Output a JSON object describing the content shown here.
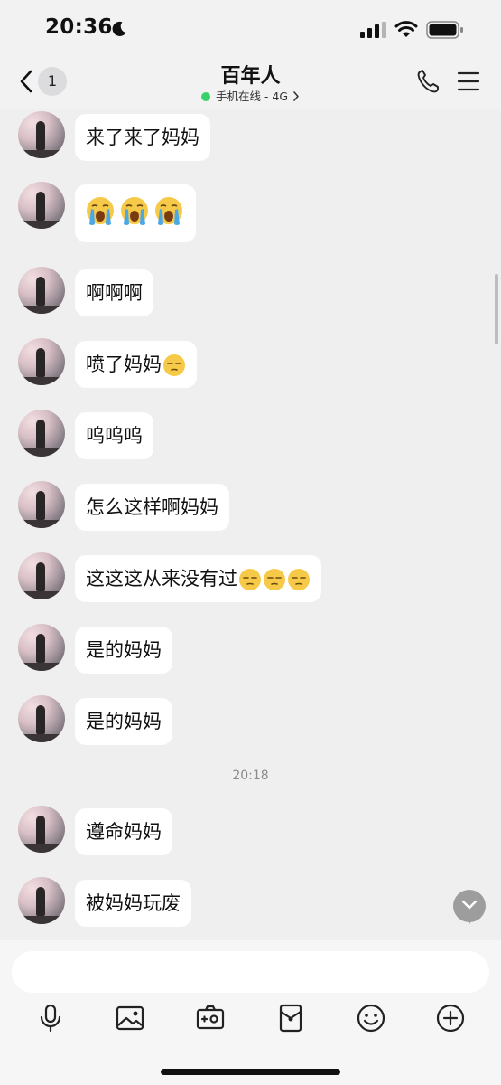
{
  "status_bar": {
    "time": "20:36",
    "icons": [
      "moon-icon",
      "signal-icon",
      "wifi-icon",
      "battery-icon"
    ]
  },
  "nav": {
    "unread_count": "1",
    "title": "百年人",
    "status": "手机在线 - 4G",
    "icons": [
      "back-chevron-icon",
      "phone-icon",
      "menu-icon"
    ]
  },
  "messages": [
    {
      "text": "来了来了妈妈"
    },
    {
      "emoji": [
        "loudly-crying-emoji",
        "loudly-crying-emoji",
        "loudly-crying-emoji"
      ]
    },
    {
      "text": "啊啊啊"
    },
    {
      "text": "喷了妈妈",
      "emoji": [
        "unamused-emoji"
      ]
    },
    {
      "text": "呜呜呜"
    },
    {
      "text": "怎么这样啊妈妈"
    },
    {
      "text": "这这这从来没有过",
      "emoji": [
        "unamused-emoji",
        "unamused-emoji",
        "unamused-emoji"
      ]
    },
    {
      "text": "是的妈妈"
    },
    {
      "text": "是的妈妈"
    },
    {
      "text": "遵命妈妈"
    },
    {
      "text": "被妈妈玩废"
    }
  ],
  "time_divider": "20:18",
  "input": {
    "value": "",
    "placeholder": ""
  },
  "toolbar": [
    "microphone-icon",
    "image-icon",
    "camera-icon",
    "red-packet-icon",
    "emoji-icon",
    "plus-icon"
  ],
  "colors": {
    "background": "#efefef",
    "bubble": "#ffffff",
    "online_dot": "#3bd16a",
    "emoji_face": "#f7c948",
    "tears": "#4aa8e8"
  }
}
